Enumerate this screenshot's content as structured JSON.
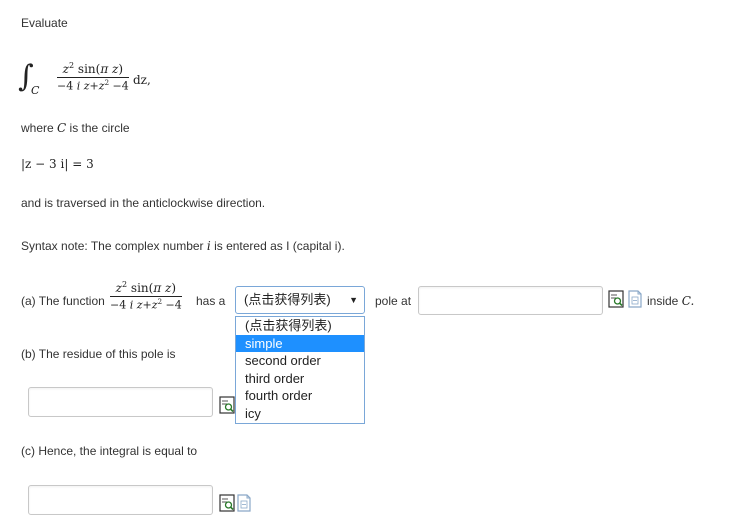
{
  "intro": {
    "evaluate": "Evaluate",
    "integral": {
      "int_sign": "∫",
      "contour": "C",
      "num_parts": [
        "z",
        "2",
        " sin(",
        "π",
        "z",
        ")"
      ],
      "den_parts": [
        "−4",
        "i",
        "z",
        "+",
        "z",
        "2",
        "−4"
      ],
      "dz": "dz,"
    },
    "where_prefix": "where ",
    "where_var": "C",
    "where_suffix": " is the circle",
    "circle_eq": "|z − 3 i| = 3",
    "traversed": "and is traversed in the anticlockwise direction.",
    "syntax_prefix": "Syntax note: The complex number ",
    "syntax_var": "i",
    "syntax_suffix": " is entered as I (capital i)."
  },
  "part_a": {
    "label": "(a) The function",
    "num": "z² sin(πz)",
    "den": "−4iz+z²−4",
    "has_a": "has a",
    "select_value": "(点击获得列表)",
    "options": [
      "(点击获得列表)",
      "simple",
      "second order",
      "third order",
      "fourth order",
      "icy"
    ],
    "selected_index": 1,
    "pole_at": "pole at",
    "pole_value": "",
    "inside_prefix": "inside ",
    "inside_var": "C."
  },
  "part_b": {
    "label": "(b) The residue of this pole is",
    "value": ""
  },
  "part_c": {
    "label": "(c) Hence, the integral is equal to",
    "value": ""
  },
  "icons": [
    "preview-icon",
    "formula-icon"
  ]
}
